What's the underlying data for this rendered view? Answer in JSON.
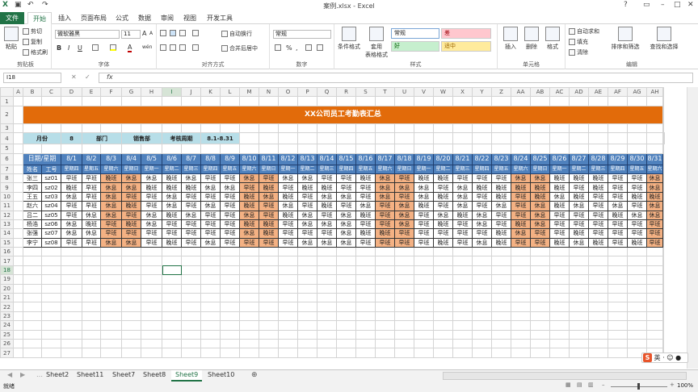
{
  "window": {
    "title": "案例.xlsx - Excel"
  },
  "tabs": [
    "文件",
    "开始",
    "插入",
    "页面布局",
    "公式",
    "数据",
    "审阅",
    "视图",
    "开发工具"
  ],
  "ribbon": {
    "clipboard": {
      "paste": "粘贴",
      "cut": "剪切",
      "copy": "复制",
      "format_painter": "格式刷",
      "label": "剪贴板"
    },
    "font": {
      "name": "微软雅黑",
      "size": "11",
      "bold": "B",
      "italic": "I",
      "underline": "U",
      "label": "字体",
      "grow": "A",
      "shrink": "A",
      "color_a": "A",
      "wen": "wén"
    },
    "align": {
      "wrap": "自动换行",
      "merge": "合并后居中",
      "label": "对齐方式"
    },
    "number": {
      "format": "常规",
      "label": "数字",
      "percent": "%",
      "comma": ","
    },
    "styles": {
      "cond": "条件格式",
      "table": "套用\n表格格式",
      "normal": "常规",
      "bad": "差",
      "good": "好",
      "neutral": "适中",
      "label": "样式"
    },
    "cells": {
      "insert": "插入",
      "delete": "删除",
      "format": "格式",
      "label": "单元格"
    },
    "edit": {
      "autosum": "自动求和",
      "fill": "填充",
      "clear": "清除",
      "sort": "排序和筛选",
      "find": "查找和选择",
      "label": "编辑"
    }
  },
  "formula_bar": {
    "name_box": "I18",
    "fx": "fx",
    "value": ""
  },
  "columns": [
    "A",
    "B",
    "C",
    "D",
    "E",
    "F",
    "G",
    "H",
    "I",
    "J",
    "K",
    "L",
    "M",
    "N",
    "O",
    "P",
    "Q",
    "R",
    "S",
    "T",
    "U",
    "V",
    "W",
    "X",
    "Y",
    "Z",
    "AA",
    "AB",
    "AC",
    "AD",
    "AE",
    "AF",
    "AG",
    "AH"
  ],
  "rows": [
    "1",
    "2",
    "3",
    "4",
    "5",
    "6",
    "7",
    "8",
    "9",
    "10",
    "11",
    "12",
    "13",
    "14",
    "15",
    "16",
    "17",
    "18",
    "19",
    "20",
    "21",
    "22",
    "23",
    "24",
    "25",
    "26",
    "27"
  ],
  "sheet": {
    "title": "XX公司员工考勤表汇总",
    "info": {
      "month_label": "月份",
      "month": "8",
      "dept_label": "部门",
      "dept": "销售部",
      "period_label": "考核周期",
      "period": "8.1-8.31"
    },
    "header_date_label": "日期/星期",
    "header_name": "姓名",
    "header_id": "工号",
    "dates": [
      "8/1",
      "8/2",
      "8/3",
      "8/4",
      "8/5",
      "8/6",
      "8/7",
      "8/8",
      "8/9",
      "8/10",
      "8/11",
      "8/12",
      "8/13",
      "8/14",
      "8/15",
      "8/16",
      "8/17",
      "8/18",
      "8/19",
      "8/20",
      "8/21",
      "8/22",
      "8/23",
      "8/24",
      "8/25",
      "8/26",
      "8/27",
      "8/28",
      "8/29",
      "8/30",
      "8/31"
    ],
    "weekdays": [
      "星期四",
      "星期五",
      "星期六",
      "星期日",
      "星期一",
      "星期二",
      "星期三",
      "星期四",
      "星期五",
      "星期六",
      "星期日",
      "星期一",
      "星期二",
      "星期三",
      "星期四",
      "星期五",
      "星期六",
      "星期日",
      "星期一",
      "星期二",
      "星期三",
      "星期四",
      "星期五",
      "星期六",
      "星期日",
      "星期一",
      "星期二",
      "星期三",
      "星期四",
      "星期五",
      "星期六"
    ],
    "employees": [
      {
        "name": "张三",
        "id": "sz01",
        "shifts": [
          "早班",
          "早班",
          "晚班",
          "休息",
          "休息",
          "晚班",
          "休息",
          "早班",
          "早班",
          "休息",
          "早班",
          "休息",
          "休息",
          "早班",
          "早班",
          "晚班",
          "休息",
          "早班",
          "晚班",
          "晚班",
          "早班",
          "早班",
          "早班",
          "休息",
          "休息",
          "晚班",
          "晚班",
          "晚班",
          "早班",
          "早班",
          "休息"
        ]
      },
      {
        "name": "李四",
        "id": "sz02",
        "shifts": [
          "晚班",
          "早班",
          "休息",
          "休息",
          "晚班",
          "晚班",
          "晚班",
          "休息",
          "休息",
          "早班",
          "晚班",
          "早班",
          "晚班",
          "晚班",
          "早班",
          "早班",
          "休息",
          "休息",
          "休息",
          "早班",
          "休息",
          "晚班",
          "晚班",
          "晚班",
          "晚班",
          "晚班",
          "早班",
          "晚班",
          "早班",
          "早班",
          "休息"
        ]
      },
      {
        "name": "王五",
        "id": "sz03",
        "shifts": [
          "休息",
          "早班",
          "休息",
          "早班",
          "早班",
          "休息",
          "早班",
          "早班",
          "早班",
          "晚班",
          "休息",
          "晚班",
          "早班",
          "休息",
          "休息",
          "早班",
          "休息",
          "早班",
          "休息",
          "晚班",
          "休息",
          "早班",
          "晚班",
          "早班",
          "晚班",
          "休息",
          "晚班",
          "早班",
          "早班",
          "晚班",
          "晚班"
        ]
      },
      {
        "name": "赵六",
        "id": "sz04",
        "shifts": [
          "早班",
          "早班",
          "休息",
          "晚班",
          "早班",
          "休息",
          "早班",
          "休息",
          "早班",
          "晚班",
          "早班",
          "休息",
          "早班",
          "晚班",
          "早班",
          "休息",
          "早班",
          "休息",
          "晚班",
          "早班",
          "休息",
          "早班",
          "休息",
          "早班",
          "休息",
          "晚班",
          "休息",
          "早班",
          "休息",
          "早班",
          "休息"
        ]
      },
      {
        "name": "吕二",
        "id": "sz05",
        "shifts": [
          "早班",
          "休息",
          "休息",
          "早班",
          "休息",
          "晚班",
          "休息",
          "早班",
          "早班",
          "休息",
          "早班",
          "晚班",
          "休息",
          "早班",
          "休息",
          "晚班",
          "早班",
          "休息",
          "早班",
          "休息",
          "晚班",
          "休息",
          "早班",
          "早班",
          "休息",
          "早班",
          "早班",
          "早班",
          "晚班",
          "休息",
          "休息"
        ]
      },
      {
        "name": "杨浩",
        "id": "sz06",
        "shifts": [
          "休息",
          "晚班",
          "早班",
          "晚班",
          "休息",
          "早班",
          "早班",
          "早班",
          "早班",
          "晚班",
          "晚班",
          "早班",
          "休息",
          "休息",
          "休息",
          "早班",
          "早班",
          "休息",
          "早班",
          "晚班",
          "早班",
          "休息",
          "早班",
          "晚班",
          "休息",
          "早班",
          "早班",
          "早班",
          "早班",
          "早班",
          "早班"
        ]
      },
      {
        "name": "张强",
        "id": "sz07",
        "shifts": [
          "休息",
          "休息",
          "早班",
          "早班",
          "早班",
          "早班",
          "早班",
          "早班",
          "早班",
          "休息",
          "晚班",
          "早班",
          "早班",
          "早班",
          "休息",
          "晚班",
          "晚班",
          "早班",
          "早班",
          "早班",
          "早班",
          "早班",
          "晚班",
          "休息",
          "早班",
          "早班",
          "晚班",
          "早班",
          "早班",
          "早班",
          "早班"
        ]
      },
      {
        "name": "李宁",
        "id": "sz08",
        "shifts": [
          "早班",
          "早班",
          "休息",
          "休息",
          "早班",
          "晚班",
          "早班",
          "休息",
          "早班",
          "早班",
          "早班",
          "早班",
          "休息",
          "休息",
          "休息",
          "早班",
          "早班",
          "早班",
          "早班",
          "晚班",
          "早班",
          "休息",
          "晚班",
          "早班",
          "早班",
          "晚班",
          "休息",
          "晚班",
          "早班",
          "晚班",
          "早班"
        ]
      }
    ]
  },
  "sheet_tabs": [
    "Sheet2",
    "Sheet11",
    "Sheet7",
    "Sheet8",
    "Sheet9",
    "Sheet10"
  ],
  "active_sheet": "Sheet9",
  "status": {
    "ready": "就绪",
    "zoom": "100%"
  },
  "colors": {
    "title_bg": "#e26b0a",
    "header_bg": "#4f81bd",
    "info_bg": "#b7dee8",
    "weekend_bg": "#f4b183",
    "accent": "#217346"
  }
}
